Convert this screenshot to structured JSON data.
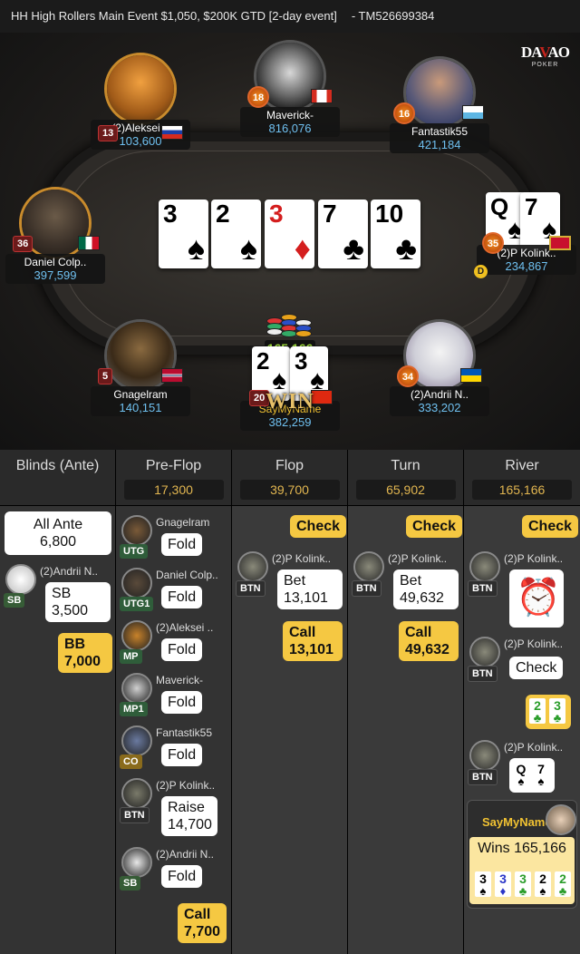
{
  "header": {
    "title": "HH  High Rollers Main Event $1,050, $200K GTD [2-day event]",
    "tournament_id": "-  TM526699384"
  },
  "logo": {
    "brand_a": "DA",
    "brand_b": "V",
    "brand_c": "AO",
    "sub": "POKER"
  },
  "seats": [
    {
      "id": "aleksei",
      "name": "(2)Aleksei ..",
      "stack": "103,600",
      "level": "13",
      "flag": "russia"
    },
    {
      "id": "maverick",
      "name": "Maverick-",
      "stack": "816,076",
      "level": "18",
      "flag": "canada"
    },
    {
      "id": "fantastik",
      "name": "Fantastik55",
      "stack": "421,184",
      "level": "16",
      "flag": "san-marino"
    },
    {
      "id": "daniel",
      "name": "Daniel Colp..",
      "stack": "397,599",
      "level": "36",
      "flag": "mexico"
    },
    {
      "id": "pkolink",
      "name": "(2)P Kolink..",
      "stack": "234,867",
      "level": "35",
      "flag": "montenegro"
    },
    {
      "id": "gnagelram",
      "name": "Gnagelram",
      "stack": "140,151",
      "level": "5",
      "flag": "norway"
    },
    {
      "id": "saymyname",
      "name": "SayMyName",
      "stack": "382,259",
      "level": "20",
      "flag": "hong-kong"
    },
    {
      "id": "andrii",
      "name": "(2)Andrii N..",
      "stack": "333,202",
      "level": "34",
      "flag": "ukraine"
    }
  ],
  "board": [
    {
      "rank": "3",
      "suit": "♠",
      "color": "black"
    },
    {
      "rank": "2",
      "suit": "♠",
      "color": "black"
    },
    {
      "rank": "3",
      "suit": "♦",
      "color": "red"
    },
    {
      "rank": "7",
      "suit": "♣",
      "color": "black"
    },
    {
      "rank": "10",
      "suit": "♣",
      "color": "black"
    }
  ],
  "hole_pkolink": [
    {
      "rank": "Q",
      "suit": "♠"
    },
    {
      "rank": "7",
      "suit": "♠"
    }
  ],
  "hole_saymyname": [
    {
      "rank": "2",
      "suit": "♠"
    },
    {
      "rank": "3",
      "suit": "♠"
    }
  ],
  "pot": "165,166",
  "dealer_button": "D",
  "win_banner": "WIN",
  "columns": {
    "blinds": {
      "title": "Blinds (Ante)"
    },
    "preflop": {
      "title": "Pre-Flop",
      "pot": "17,300"
    },
    "flop": {
      "title": "Flop",
      "pot": "39,700"
    },
    "turn": {
      "title": "Turn",
      "pot": "65,902"
    },
    "river": {
      "title": "River",
      "pot": "165,166"
    }
  },
  "blinds_actions": {
    "all_ante_label": "All Ante",
    "all_ante_amount": "6,800",
    "sb_player": "(2)Andrii N..",
    "sb_pos": "SB",
    "sb_label": "SB",
    "sb_amount": "3,500",
    "bb_label": "BB",
    "bb_amount": "7,000"
  },
  "preflop_actions": [
    {
      "player": "Gnagelram",
      "pos": "UTG",
      "action": "Fold"
    },
    {
      "player": "Daniel Colp..",
      "pos": "UTG1",
      "action": "Fold"
    },
    {
      "player": "(2)Aleksei ..",
      "pos": "MP",
      "action": "Fold"
    },
    {
      "player": "Maverick-",
      "pos": "MP1",
      "action": "Fold"
    },
    {
      "player": "Fantastik55",
      "pos": "CO",
      "action": "Fold"
    },
    {
      "player": "(2)P Kolink..",
      "pos": "BTN",
      "action": "Raise",
      "amount": "14,700"
    },
    {
      "player": "(2)Andrii N..",
      "pos": "SB",
      "action": "Fold"
    }
  ],
  "preflop_call": {
    "action": "Call",
    "amount": "7,700"
  },
  "flop_actions": {
    "check": "Check",
    "player": "(2)P Kolink..",
    "pos": "BTN",
    "bet": "Bet",
    "bet_amount": "13,101",
    "call": "Call",
    "call_amount": "13,101"
  },
  "turn_actions": {
    "check": "Check",
    "player": "(2)P Kolink..",
    "pos": "BTN",
    "bet": "Bet",
    "bet_amount": "49,632",
    "call": "Call",
    "call_amount": "49,632"
  },
  "river_actions": {
    "check": "Check",
    "player": "(2)P Kolink..",
    "pos": "BTN",
    "timer_icon": "alarm-clock-icon",
    "check2": "Check",
    "show_cards": [
      {
        "rank": "2",
        "suit": "♣"
      },
      {
        "rank": "3",
        "suit": "♣"
      }
    ],
    "muck_cards": [
      {
        "rank": "Q",
        "suit": "♠"
      },
      {
        "rank": "7",
        "suit": "♠"
      }
    ],
    "winner": "SayMyName",
    "wins_label": "Wins 165,166",
    "winning_hand": [
      {
        "rank": "3",
        "suit": "♠"
      },
      {
        "rank": "3",
        "suit": "♦"
      },
      {
        "rank": "3",
        "suit": "♣"
      },
      {
        "rank": "2",
        "suit": "♠"
      },
      {
        "rank": "2",
        "suit": "♣"
      }
    ]
  }
}
